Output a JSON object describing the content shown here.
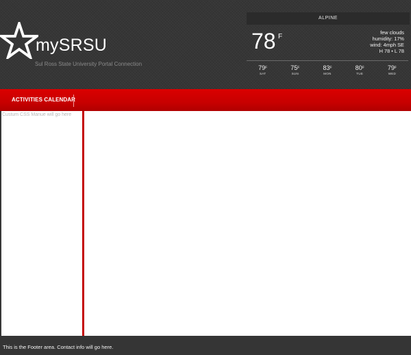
{
  "header": {
    "logo_text": "mySRSU",
    "tagline": "Sul Ross State University Portal Connection"
  },
  "weather": {
    "location": "ALPINE",
    "current_temp": "78",
    "unit": "F",
    "conditions": "few clouds",
    "humidity": "humidity: 17%",
    "wind": "wind: 4mph SE",
    "high_low": "H 78 • L 78",
    "forecast": [
      {
        "temp": "79",
        "unit": "F",
        "day": "SAT"
      },
      {
        "temp": "75",
        "unit": "F",
        "day": "SUN"
      },
      {
        "temp": "83",
        "unit": "F",
        "day": "MON"
      },
      {
        "temp": "80",
        "unit": "F",
        "day": "TUE"
      },
      {
        "temp": "79",
        "unit": "F",
        "day": "WED"
      }
    ]
  },
  "nav": {
    "items": [
      {
        "label": "ACTIVITIES CALENDAR"
      }
    ]
  },
  "sidebar": {
    "text": "Custum CSS Manue will go here"
  },
  "footer": {
    "text": "This is the Footer area. Contact info will go here."
  },
  "colors": {
    "nav_red": "#c80000",
    "background": "#363636"
  }
}
